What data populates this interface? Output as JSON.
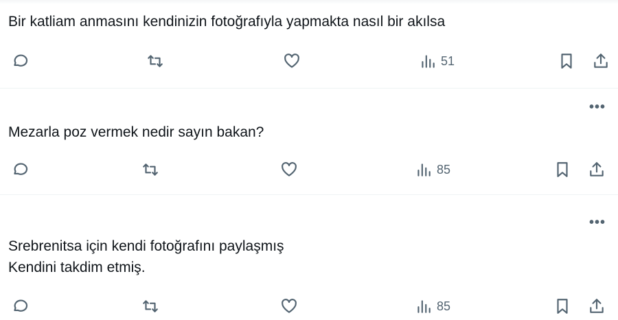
{
  "tweets": [
    {
      "text": "Bir katliam anmasını kendinizin fotoğrafıyla yapmakta nasıl bir akılsa",
      "views": "51",
      "show_more": false
    },
    {
      "text": "Mezarla poz vermek nedir sayın bakan?",
      "views": "85",
      "show_more": true
    },
    {
      "text": "Srebrenitsa için kendi fotoğrafını paylaşmış\nKendini takdim etmiş.",
      "views": "85",
      "show_more": true
    }
  ],
  "more_label": "•••",
  "icons": {
    "reply": "reply-icon",
    "retweet": "retweet-icon",
    "like": "like-icon",
    "views": "views-icon",
    "bookmark": "bookmark-icon",
    "share": "share-icon"
  },
  "colors": {
    "text": "#0f1419",
    "icon": "#536471",
    "divider": "#eff3f4"
  }
}
